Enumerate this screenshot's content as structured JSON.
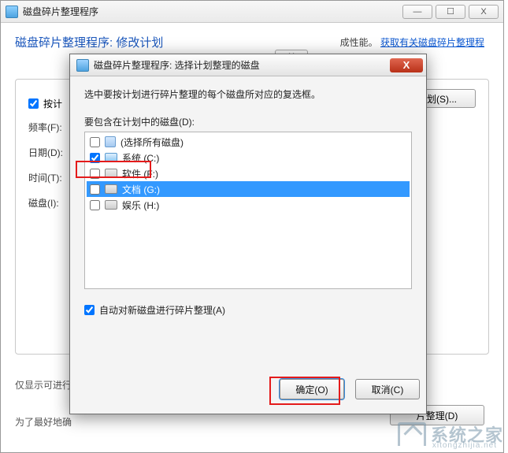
{
  "root_window": {
    "title": "磁盘碎片整理程序",
    "win_min": "—",
    "win_max": "☐",
    "win_close": "X"
  },
  "modify_dialog": {
    "title": "磁盘碎片整理程序: 修改计划",
    "close_sym": "X",
    "perf_text": "成性能。",
    "perf_link": "获取有关磁盘碎片整理程",
    "check_label": "按计",
    "freq_label": "频率(F):",
    "date_label": "日期(D):",
    "time_label": "时间(T):",
    "disk_label": "磁盘(I):",
    "right_btn": "划(S)...",
    "info1": "仅显示可进行",
    "info2": "为了最好地确",
    "bottom_btn": "片整理(D)"
  },
  "modal": {
    "title": "磁盘碎片整理程序: 选择计划整理的磁盘",
    "close_sym": "X",
    "instruction": "选中要按计划进行碎片整理的每个磁盘所对应的复选框。",
    "list_label": "要包含在计划中的磁盘(D):",
    "disks": {
      "all": "(选择所有磁盘)",
      "c": "系统 (C:)",
      "f": "软件 (F:)",
      "g": "文档 (G:)",
      "h": "娱乐 (H:)"
    },
    "auto_defrag": "自动对新磁盘进行碎片整理(A)",
    "ok": "确定(O)",
    "cancel": "取消(C)"
  },
  "watermark": {
    "text": "系统之家",
    "sub": "xitongzhijia.net"
  }
}
